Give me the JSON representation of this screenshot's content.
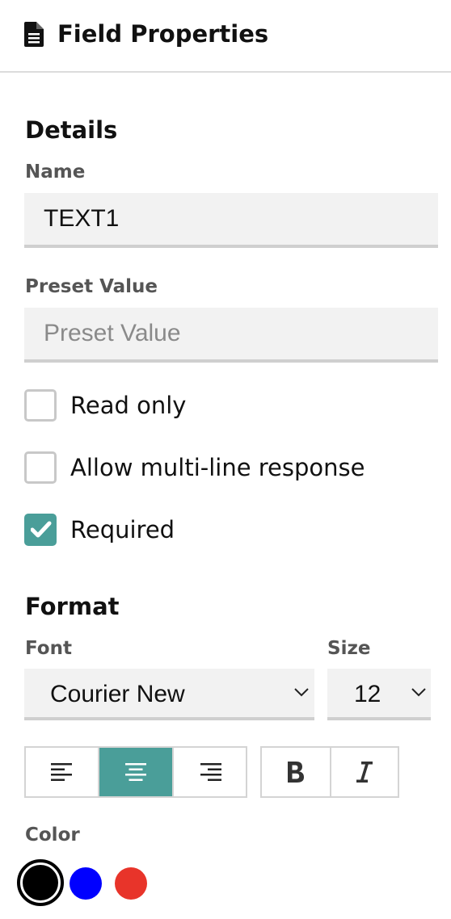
{
  "header": {
    "title": "Field Properties",
    "icon": "document-icon"
  },
  "details": {
    "section_title": "Details",
    "name_label": "Name",
    "name_value": "TEXT1",
    "preset_label": "Preset Value",
    "preset_placeholder": "Preset Value",
    "preset_value": ""
  },
  "options": [
    {
      "label": "Read only",
      "checked": false
    },
    {
      "label": "Allow multi-line response",
      "checked": false
    },
    {
      "label": "Required",
      "checked": true
    }
  ],
  "format": {
    "section_title": "Format",
    "font_label": "Font",
    "font_value": "Courier New",
    "size_label": "Size",
    "size_value": "12",
    "alignment": {
      "selected": "center",
      "options": [
        "left",
        "center",
        "right"
      ]
    },
    "style_buttons": [
      "bold",
      "italic"
    ]
  },
  "color": {
    "label": "Color",
    "swatches": [
      {
        "name": "black",
        "hex": "#000000",
        "selected": true
      },
      {
        "name": "blue",
        "hex": "#0000ff",
        "selected": false
      },
      {
        "name": "red",
        "hex": "#e8342a",
        "selected": false
      }
    ]
  },
  "theme": {
    "accent": "#4a9e99"
  }
}
